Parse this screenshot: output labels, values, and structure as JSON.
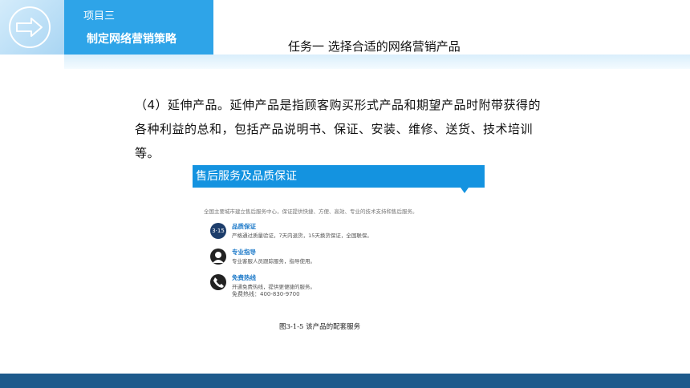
{
  "header": {
    "project_label": "项目三",
    "strategy_title": "制定网络营销策略",
    "task_title": "任务一   选择合适的网络营销产品"
  },
  "body": {
    "line1": "（4）延伸产品。延伸产品是指顾客购买形式产品和期望产品时附带获得的",
    "line2": "各种利益的总和，包括产品说明书、保证、安装、维修、送货、技术培训",
    "line3": "等。"
  },
  "figure": {
    "banner": "售后服务及品质保证",
    "intro": "全国主要城市建立售后服务中心，保证提供快捷、方便、高效、专业的技术支持和售后服务。",
    "services": [
      {
        "icon": "quality-315-icon",
        "icon_text": "3·15",
        "title": "品质保证",
        "desc": "严格通过质量验证，7天内退货，15天换货保证，全国联保。",
        "desc2": ""
      },
      {
        "icon": "support-agent-icon",
        "icon_text": "",
        "title": "专业指导",
        "desc": "专业客服人员跟踪服务，指导使用。",
        "desc2": ""
      },
      {
        "icon": "phone-icon",
        "icon_text": "",
        "title": "免费热线",
        "desc": "开通免费热线，提供更便捷的服务。",
        "desc2": "免费热线：400-830-9700"
      }
    ],
    "caption": "图3-1-5 该产品的配套服务"
  },
  "colors": {
    "header_blue": "#2ea4e8",
    "banner_blue": "#1493e0",
    "footer_blue": "#1e5a8c"
  }
}
